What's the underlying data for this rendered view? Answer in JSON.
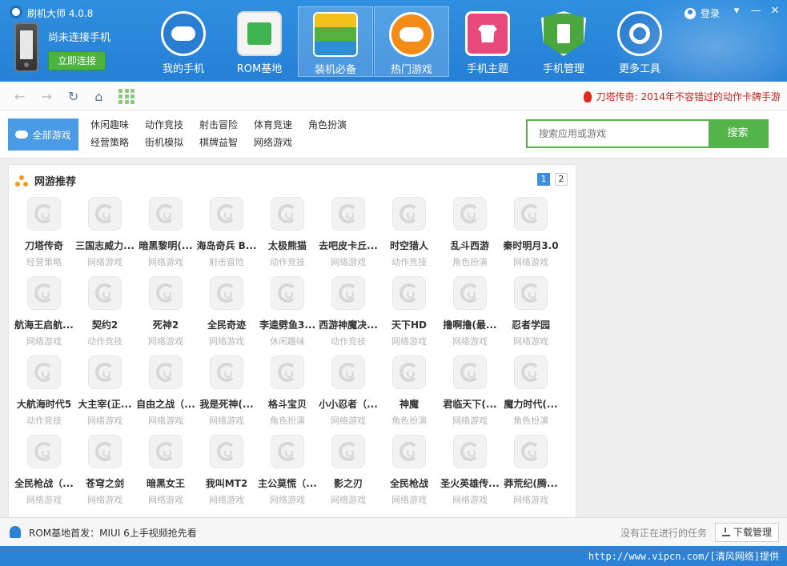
{
  "app": {
    "title": "刷机大师 4.0.8",
    "login": "登录"
  },
  "window_controls": {
    "menu": "▾",
    "minimize": "—",
    "close": "✕"
  },
  "device": {
    "status": "尚未连接手机",
    "connect_label": "立即连接"
  },
  "nav": [
    {
      "label": "我的手机",
      "icon": "cloud-icon"
    },
    {
      "label": "ROM基地",
      "icon": "bag-android-icon"
    },
    {
      "label": "装机必备",
      "icon": "layers-icon"
    },
    {
      "label": "热门游戏",
      "icon": "gamepad-icon"
    },
    {
      "label": "手机主题",
      "icon": "tshirt-icon"
    },
    {
      "label": "手机管理",
      "icon": "shield-phone-icon"
    },
    {
      "label": "更多工具",
      "icon": "wrench-icon"
    }
  ],
  "nav_active": "热门游戏",
  "toolbar": {
    "promo": "刀塔传奇: 2014年不容错过的动作卡牌手游"
  },
  "filter": {
    "all_label": "全部游戏",
    "categories": [
      "休闲趣味",
      "动作竞技",
      "射击冒险",
      "体育竞速",
      "角色扮演",
      "经营策略",
      "街机模拟",
      "棋牌益智",
      "网络游戏"
    ]
  },
  "search": {
    "placeholder": "搜索应用或游戏",
    "button": "搜索"
  },
  "section": {
    "title": "网游推荐",
    "pages": [
      "1",
      "2"
    ]
  },
  "games": [
    {
      "name": "刀塔传奇",
      "cat": "经营策略"
    },
    {
      "name": "三国志威力...",
      "cat": "网络游戏"
    },
    {
      "name": "暗黑黎明(...",
      "cat": "网络游戏"
    },
    {
      "name": "海岛奇兵 B...",
      "cat": "射击冒险"
    },
    {
      "name": "太极熊猫",
      "cat": "动作竞技"
    },
    {
      "name": "去吧皮卡丘...",
      "cat": "网络游戏"
    },
    {
      "name": "时空猎人",
      "cat": "动作竞技"
    },
    {
      "name": "乱斗西游",
      "cat": "角色扮演"
    },
    {
      "name": "秦时明月3.0",
      "cat": "网络游戏"
    },
    {
      "name": "航海王启航...",
      "cat": "网络游戏"
    },
    {
      "name": "契约2",
      "cat": "动作竞技"
    },
    {
      "name": "死神2",
      "cat": "网络游戏"
    },
    {
      "name": "全民奇迹",
      "cat": "网络游戏"
    },
    {
      "name": "李逵劈鱼3...",
      "cat": "休闲趣味"
    },
    {
      "name": "西游神魔决...",
      "cat": "动作竞技"
    },
    {
      "name": "天下HD",
      "cat": "网络游戏"
    },
    {
      "name": "撸啊撸(最...",
      "cat": "网络游戏"
    },
    {
      "name": "忍者学园",
      "cat": "网络游戏"
    },
    {
      "name": "大航海时代5",
      "cat": "动作竞技"
    },
    {
      "name": "大主宰(正...",
      "cat": "网络游戏"
    },
    {
      "name": "自由之战（...",
      "cat": "网络游戏"
    },
    {
      "name": "我是死神(...",
      "cat": "网络游戏"
    },
    {
      "name": "格斗宝贝",
      "cat": "角色扮演"
    },
    {
      "name": "小小忍者（...",
      "cat": "网络游戏"
    },
    {
      "name": "神魔",
      "cat": "角色扮演"
    },
    {
      "name": "君临天下(...",
      "cat": "网络游戏"
    },
    {
      "name": "魔力时代(...",
      "cat": "角色扮演"
    },
    {
      "name": "全民枪战（...",
      "cat": "网络游戏"
    },
    {
      "name": "苍穹之剑",
      "cat": "网络游戏"
    },
    {
      "name": "暗黑女王",
      "cat": "网络游戏"
    },
    {
      "name": "我叫MT2",
      "cat": "网络游戏"
    },
    {
      "name": "主公莫慌（...",
      "cat": "网络游戏"
    },
    {
      "name": "影之刃",
      "cat": "网络游戏"
    },
    {
      "name": "全民枪战",
      "cat": "网络游戏"
    },
    {
      "name": "圣火英雄传...",
      "cat": "网络游戏"
    },
    {
      "name": "莽荒纪(腾...",
      "cat": "网络游戏"
    }
  ],
  "status": {
    "news": "ROM基地首发：MIUI 6上手视频抢先看",
    "tasks": "没有正在进行的任务",
    "download": "下载管理"
  },
  "watermark": "http://www.vipcn.com/[清风网络]提供",
  "colors": {
    "brand_blue": "#2b82d6",
    "accent_green": "#53b447",
    "promo_red": "#c8221b"
  }
}
